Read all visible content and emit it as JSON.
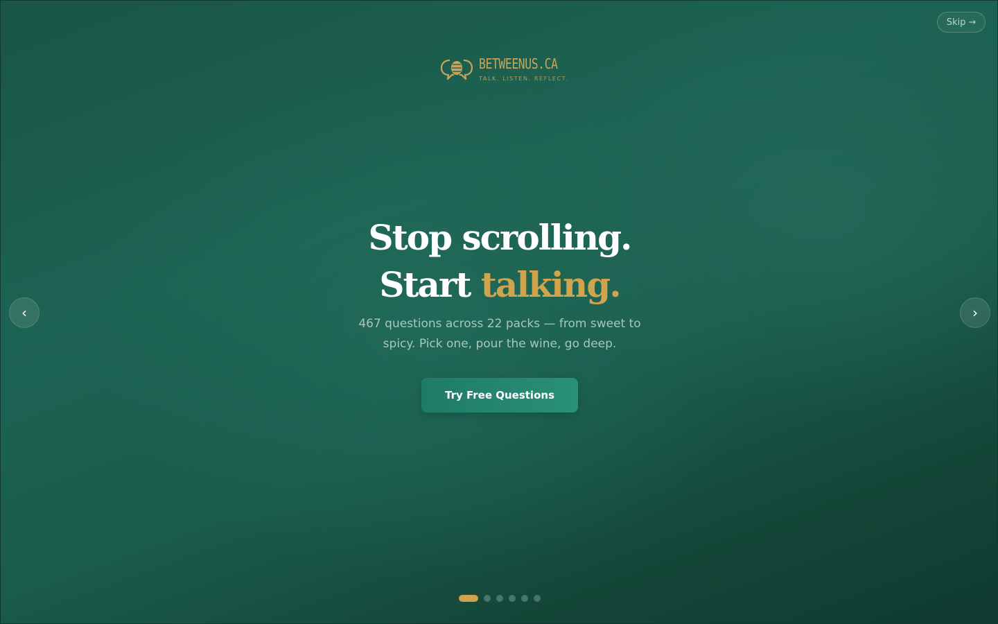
{
  "colors": {
    "brand_gold": "#cfa44d",
    "background_green": "#1d6353",
    "cta_green": "#228471"
  },
  "skip": {
    "label": "Skip",
    "icon": "arrow-right-icon",
    "glyph": "→"
  },
  "logo": {
    "name": "BETWEENUS.CA",
    "tagline": "TALK. LISTEN. REFLECT.",
    "icon": "speech-bubbles-logo-icon"
  },
  "hero": {
    "headline_line1": "Stop scrolling.",
    "headline_line2_start": "Start ",
    "headline_line2_accent": "talking.",
    "subtext": "467 questions across 22 packs — from sweet to spicy. Pick one, pour the wine, go deep.",
    "cta_label": "Try Free Questions"
  },
  "carousel": {
    "prev_icon": "chevron-left-icon",
    "prev_glyph": "‹",
    "next_icon": "chevron-right-icon",
    "next_glyph": "›",
    "slide_count": 6,
    "active_index": 0
  }
}
